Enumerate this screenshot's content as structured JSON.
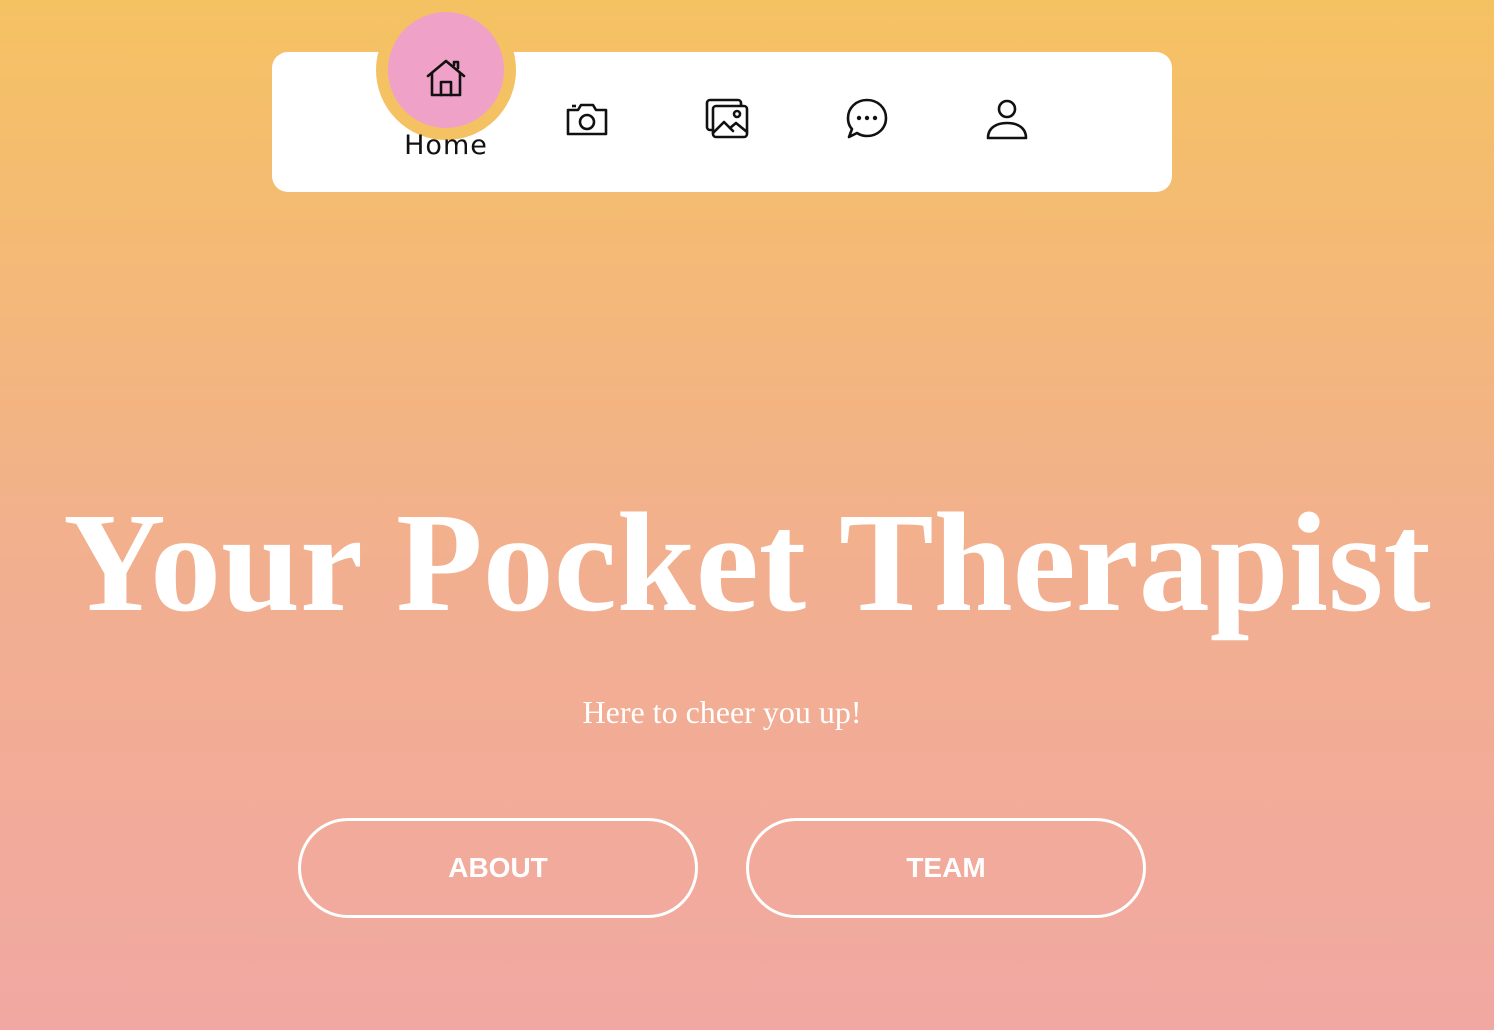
{
  "nav": {
    "items": [
      {
        "label": "Home",
        "icon": "home-icon",
        "active": true
      },
      {
        "label": "",
        "icon": "camera-icon",
        "active": false
      },
      {
        "label": "",
        "icon": "images-icon",
        "active": false
      },
      {
        "label": "",
        "icon": "chat-icon",
        "active": false
      },
      {
        "label": "",
        "icon": "user-icon",
        "active": false
      }
    ]
  },
  "hero": {
    "title": "Your Pocket Therapist",
    "subtitle": "Here to cheer you up!"
  },
  "buttons": {
    "about_label": "ABOUT",
    "team_label": "TEAM"
  },
  "colors": {
    "gradient_top": "#F5C262",
    "gradient_bottom": "#F1A8A2",
    "active_bubble": "#EFA1C8",
    "bubble_ring": "#F4C163",
    "nav_background": "#FFFFFF",
    "text_light": "#FFFFFF"
  }
}
